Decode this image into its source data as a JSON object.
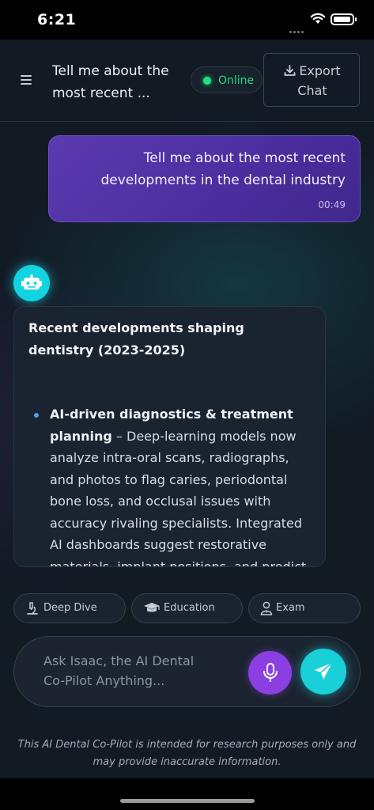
{
  "status_bar": {
    "time": "6:21"
  },
  "header": {
    "title": "Tell me about the most recent ...",
    "status": "Online",
    "export_label_line1": "Export",
    "export_label_line2": "Chat"
  },
  "messages": {
    "user": {
      "text": "Tell me about the most recent developments in the dental industry",
      "time": "00:49"
    },
    "assistant": {
      "heading": "Recent developments shaping dentistry (2023-2025)",
      "bullet_title": "AI-driven diagnostics & treatment planning",
      "bullet_text": " – Deep-learning models now analyze intra-oral scans, radiographs, and photos to flag caries, periodontal bone loss, and occlusal issues with accuracy rivaling specialists. Integrated AI dashboards suggest restorative materials, implant positions, and predict treatment outcomes."
    }
  },
  "chips": [
    {
      "label": "Deep Dive",
      "icon": "microscope-icon"
    },
    {
      "label": "Education",
      "icon": "graduation-cap-icon"
    },
    {
      "label": "Exam",
      "icon": "user-doctor-icon"
    }
  ],
  "composer": {
    "placeholder": "Ask Isaac, the AI Dental Co-Pilot Anything..."
  },
  "disclaimer": "This AI Dental Co-Pilot is intended for research purposes only and may provide inaccurate information.",
  "colors": {
    "background": "#121a24",
    "user_bubble": "#4a2e9e",
    "accent_cyan": "#19cfd8",
    "mic_purple": "#8b3fe0",
    "online_green": "#22e07a"
  }
}
